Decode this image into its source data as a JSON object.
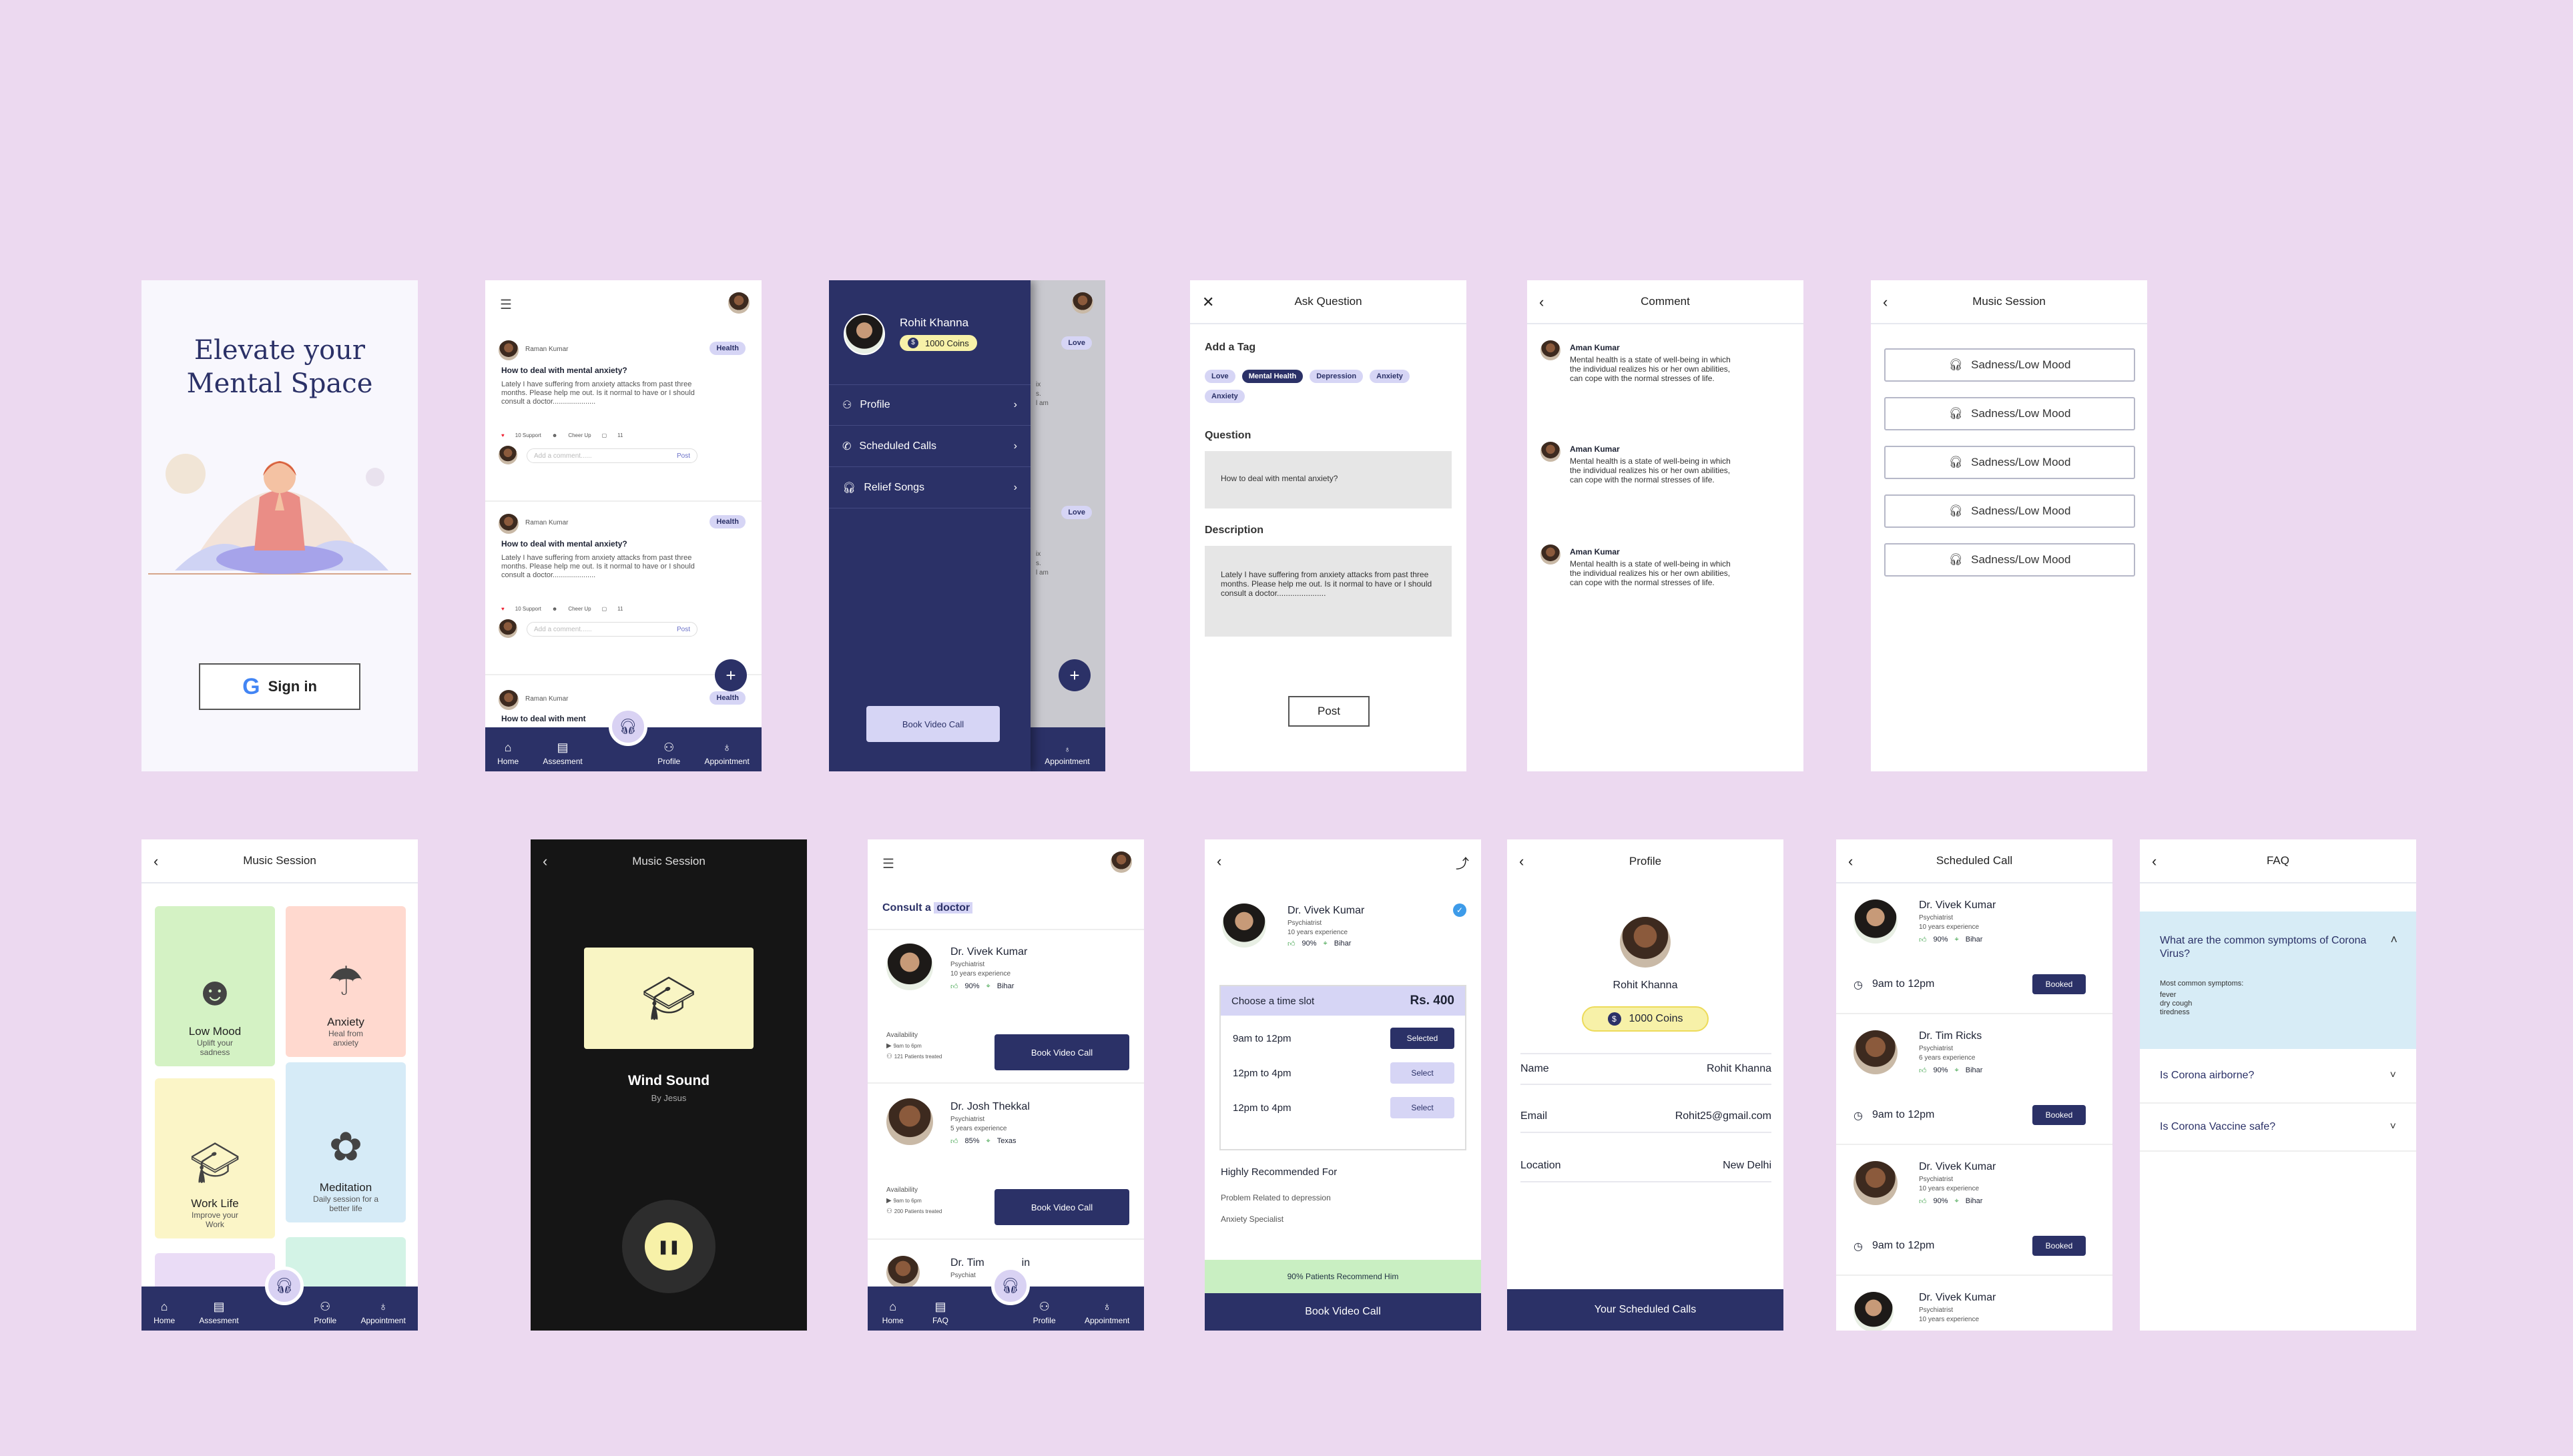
{
  "colors": {
    "background": "#ecd9f0",
    "navy": "#2b3167",
    "pill": "#d6d5f5",
    "green": "#3ea24a",
    "sky": "#d7ecf6"
  },
  "signin": {
    "title_line1": "Elevate your",
    "title_line2": "Mental Space",
    "button": "Sign in"
  },
  "nav": {
    "home": "Home",
    "assessment": "Assesment",
    "profile": "Profile",
    "appointment": "Appointment",
    "faq": "FAQ"
  },
  "feed": {
    "posts": [
      {
        "author": "Raman Kumar",
        "tag": "Health",
        "title": "How to deal with mental anxiety?",
        "body": "Lately I have suffering from anxiety attacks from past three months. Please help me out. Is it normal to have or I should consult a doctor.....................",
        "support": "10 Support",
        "cheer": "Cheer Up",
        "comments": "11",
        "comment_placeholder": "Add a comment......",
        "post_label": "Post"
      },
      {
        "author": "Raman Kumar",
        "tag": "Health",
        "title": "How to deal with mental anxiety?",
        "body": "Lately I have suffering from anxiety attacks from past three months. Please help me out. Is it normal to have or I should consult a doctor.....................",
        "support": "10 Support",
        "cheer": "Cheer Up",
        "comments": "11",
        "comment_placeholder": "Add a comment......",
        "post_label": "Post"
      },
      {
        "author": "Raman Kumar",
        "tag": "Health",
        "title": "How to deal with ment",
        "title_tail": "?"
      }
    ]
  },
  "drawer": {
    "name": "Rohit Khanna",
    "coins": "1000 Coins",
    "items": [
      "Profile",
      "Scheduled Calls",
      "Relief Songs"
    ],
    "button": "Book Video Call",
    "behind_tag": "Love",
    "behind_nav": "Appointment",
    "behind_text1": [
      "ix",
      "s.",
      "l am"
    ],
    "behind_text2": [
      "ix",
      "s.",
      "l am"
    ]
  },
  "ask": {
    "title": "Ask Question",
    "tag_label": "Add a Tag",
    "tags": [
      "Love",
      "Mental Health",
      "Depression",
      "Anxiety",
      "Anxiety"
    ],
    "question_label": "Question",
    "question_value": "How to deal with mental anxiety?",
    "description_label": "Description",
    "description_value": "Lately I have suffering from anxiety attacks from past three months. Please help me out. Is it normal to have or I should consult a doctor......................",
    "post": "Post"
  },
  "comment": {
    "title": "Comment",
    "items": [
      {
        "author": "Aman Kumar",
        "text": "Mental health is a state of well-being in which the individual realizes his or her own abilities, can cope with the normal stresses of life."
      },
      {
        "author": "Aman Kumar",
        "text": "Mental health is a state of well-being in which the individual realizes his or her own abilities, can cope with the normal stresses of life."
      },
      {
        "author": "Aman Kumar",
        "text": "Mental health is a state of well-being in which the individual realizes his or her own abilities, can cope with the normal stresses of life."
      }
    ]
  },
  "music_list": {
    "title": "Music Session",
    "items": [
      "Sadness/Low Mood",
      "Sadness/Low Mood",
      "Sadness/Low Mood",
      "Sadness/Low Mood",
      "Sadness/Low Mood"
    ]
  },
  "music_grid": {
    "title": "Music Session",
    "cards": [
      {
        "title": "Low Mood",
        "sub": "Uplift your sadness",
        "color": "#d4f2c4"
      },
      {
        "title": "Anxiety",
        "sub": "Heal from anxiety",
        "color": "#ffd9cf"
      },
      {
        "title": "Work Life",
        "sub": "Improve your Work",
        "color": "#fbf5c7"
      },
      {
        "title": "Meditation",
        "sub": "Daily session for a better life",
        "color": "#d6ebf7"
      }
    ]
  },
  "player": {
    "title": "Music Session",
    "track": "Wind Sound",
    "artist": "By Jesus"
  },
  "consult": {
    "heading1": "Consult a",
    "heading2": "doctor",
    "availability": "Availability",
    "time": "9am to 6pm",
    "doctors": [
      {
        "name": "Dr. Vivek Kumar",
        "role": "Psychiatrist",
        "exp": "10 years experience",
        "rating": "90%",
        "loc": "Bihar",
        "patients": "121 Patients treated",
        "button": "Book Video Call"
      },
      {
        "name": "Dr. Josh Thekkal",
        "role": "Psychiatrist",
        "exp": "5 years experience",
        "rating": "85%",
        "loc": "Texas",
        "patients": "200 Patients treated",
        "button": "Book Video Call"
      },
      {
        "name": "Dr. Tim",
        "name_tail": "in",
        "role": "Psychiat"
      }
    ]
  },
  "doctor_detail": {
    "name": "Dr. Vivek Kumar",
    "role": "Psychiatrist",
    "exp": "10 years experience",
    "rating": "90%",
    "loc": "Bihar",
    "slot_label": "Choose a time slot",
    "price": "Rs. 400",
    "slots": [
      {
        "time": "9am to 12pm",
        "action": "Selected"
      },
      {
        "time": "12pm to 4pm",
        "action": "Select"
      },
      {
        "time": "12pm to 4pm",
        "action": "Select"
      }
    ],
    "recommended_label": "Highly Recommended For",
    "recommended": [
      "Problem Related to depression",
      "Anxiety Specialist"
    ],
    "recommend_banner": "90% Patients Recommend Him",
    "button": "Book Video Call"
  },
  "profile": {
    "title": "Profile",
    "name": "Rohit Khanna",
    "coins": "1000 Coins",
    "fields": [
      {
        "label": "Name",
        "value": "Rohit Khanna"
      },
      {
        "label": "Email",
        "value": "Rohit25@gmail.com"
      },
      {
        "label": "Location",
        "value": "New Delhi"
      }
    ],
    "button": "Your Scheduled Calls"
  },
  "scheduled": {
    "title": "Scheduled Call",
    "calls": [
      {
        "name": "Dr. Vivek Kumar",
        "role": "Psychiatrist",
        "exp": "10 years experience",
        "rating": "90%",
        "loc": "Bihar",
        "time": "9am to 12pm",
        "status": "Booked"
      },
      {
        "name": "Dr. Tim Ricks",
        "role": "Psychiatrist",
        "exp": "6 years experience",
        "rating": "90%",
        "loc": "Bihar",
        "time": "9am to 12pm",
        "status": "Booked"
      },
      {
        "name": "Dr. Vivek Kumar",
        "role": "Psychiatrist",
        "exp": "10 years experience",
        "rating": "90%",
        "loc": "Bihar",
        "time": "9am to 12pm",
        "status": "Booked"
      },
      {
        "name": "Dr. Vivek Kumar",
        "role": "Psychiatrist",
        "exp": "10 years experience"
      }
    ]
  },
  "faq": {
    "title": "FAQ",
    "open_q": "What are the common symptoms of Corona Virus?",
    "open_a": [
      "Most common symptoms:",
      "fever",
      "dry cough",
      "tiredness"
    ],
    "questions": [
      "Is Corona airborne?",
      "Is Corona Vaccine safe?"
    ]
  }
}
